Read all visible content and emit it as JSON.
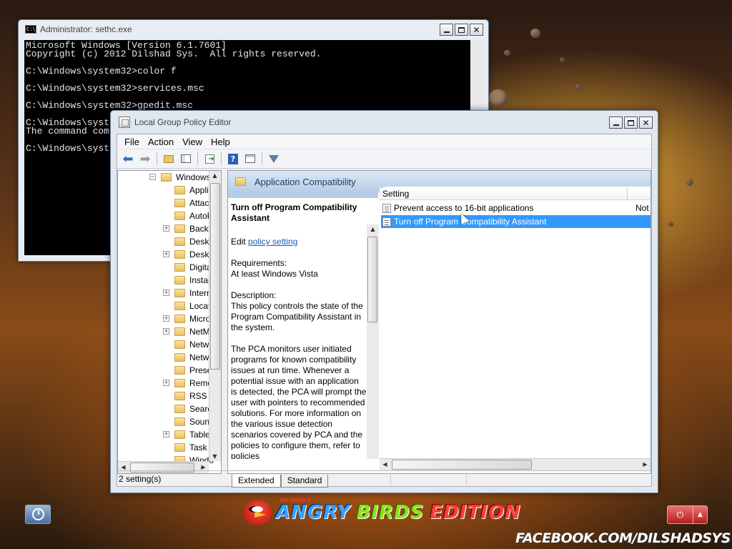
{
  "cmd": {
    "title": "Administrator: sethc.exe",
    "icon_text": "C:\\",
    "lines": [
      "Microsoft Windows [Version 6.1.7601]",
      "Copyright (c) 2012 Dilshad Sys.  All rights reserved.",
      "",
      "C:\\Windows\\system32>color f",
      "",
      "C:\\Windows\\system32>services.msc",
      "",
      "C:\\Windows\\system32>gpedit.msc",
      "",
      "C:\\Windows\\syst",
      "The command com",
      "",
      "C:\\Windows\\syst"
    ]
  },
  "gpe": {
    "title": "Local Group Policy Editor",
    "menu": [
      "File",
      "Action",
      "View",
      "Help"
    ],
    "toolbar_icons": [
      "back-arrow-icon",
      "forward-arrow-icon",
      "up-folder-icon",
      "show-hide-tree-icon",
      "export-list-icon",
      "help-icon",
      "properties-view-icon",
      "filter-icon"
    ],
    "tree": {
      "root": "Windows C",
      "items": [
        {
          "label": "Applic",
          "expandable": false,
          "selected": false
        },
        {
          "label": "Attach",
          "expandable": false,
          "selected": false
        },
        {
          "label": "AutoPl",
          "expandable": false,
          "selected": false
        },
        {
          "label": "Backup",
          "expandable": true,
          "selected": false
        },
        {
          "label": "Deskto",
          "expandable": false,
          "selected": false
        },
        {
          "label": "Deskto",
          "expandable": true,
          "selected": false
        },
        {
          "label": "Digital",
          "expandable": false,
          "selected": false
        },
        {
          "label": "Instant",
          "expandable": false,
          "selected": false
        },
        {
          "label": "Interne",
          "expandable": true,
          "selected": false
        },
        {
          "label": "Locatio",
          "expandable": false,
          "selected": false
        },
        {
          "label": "Micros",
          "expandable": true,
          "selected": false
        },
        {
          "label": "NetMe",
          "expandable": true,
          "selected": false
        },
        {
          "label": "Netwo",
          "expandable": false,
          "selected": false
        },
        {
          "label": "Netwo",
          "expandable": false,
          "selected": false
        },
        {
          "label": "Presen",
          "expandable": false,
          "selected": false
        },
        {
          "label": "Remot",
          "expandable": true,
          "selected": false
        },
        {
          "label": "RSS Fe",
          "expandable": false,
          "selected": false
        },
        {
          "label": "Search",
          "expandable": false,
          "selected": false
        },
        {
          "label": "Sound",
          "expandable": false,
          "selected": false
        },
        {
          "label": "Tablet",
          "expandable": true,
          "selected": false
        },
        {
          "label": "Task Sc",
          "expandable": false,
          "selected": false
        },
        {
          "label": "Windo",
          "expandable": false,
          "selected": false
        }
      ]
    },
    "category": "Application Compatibility",
    "description": {
      "title": "Turn off Program Compatibility Assistant",
      "edit_prefix": "Edit",
      "edit_link": "policy setting",
      "requirements_label": "Requirements:",
      "requirements": "At least Windows Vista",
      "description_label": "Description:",
      "p1": "This policy controls the state of the Program Compatibility Assistant in the system.",
      "p2": "The PCA monitors user initiated programs for known compatibility issues at run time. Whenever a potential issue with an application is detected, the PCA will prompt the user with pointers to recommended solutions.  For more information on the various issue detection scenarios covered by PCA and the policies to configure them, refer to policies"
    },
    "list": {
      "column_setting": "Setting",
      "rows": [
        {
          "setting": "Prevent access to 16-bit applications",
          "state": "Not"
        },
        {
          "setting": "Turn off Program Compatibility Assistant",
          "state": ""
        }
      ]
    },
    "tabs": [
      "Extended",
      "Standard"
    ],
    "status": "2 setting(s)"
  },
  "bottom": {
    "brand_small": "DILSHAD'S",
    "brand_part1": "ANGRY",
    "brand_part2": "BIRDS",
    "brand_part3": "EDITION",
    "facebook": "FACEBOOK.COM/DILSHADSYS"
  }
}
